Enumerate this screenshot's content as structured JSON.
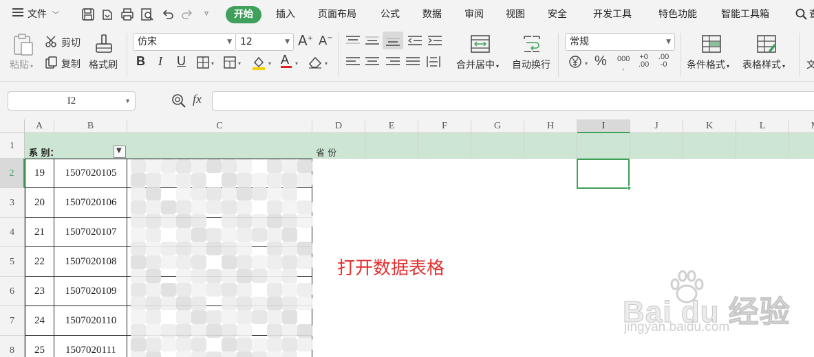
{
  "menu": {
    "file_label": "文件",
    "tabs": [
      "开始",
      "插入",
      "页面布局",
      "公式",
      "数据",
      "审阅",
      "视图",
      "安全",
      "开发工具",
      "特色功能",
      "智能工具箱",
      "查"
    ],
    "active_tab": "开始"
  },
  "ribbon": {
    "paste_label": "粘贴",
    "cut_label": "剪切",
    "copy_label": "复制",
    "format_painter_label": "格式刷",
    "font_name": "仿宋",
    "font_size": "12",
    "merge_center_label": "合并居中",
    "wrap_text_label": "自动换行",
    "number_format": "常规",
    "conditional_format_label": "条件格式",
    "table_style_label": "表格样式",
    "cut_off_label": "文",
    "bold": "B",
    "italic": "I",
    "underline": "U",
    "font_color_glyph": "A",
    "percent": "%",
    "thousands": "000",
    "inc_decimal": ".00",
    "dec_decimal": ".00",
    "inc_decimal_small": "+0",
    "dec_decimal_small": "-0",
    "font_grow": "A",
    "font_shrink": "A"
  },
  "formula_bar": {
    "name_box": "I2",
    "fx": "fx",
    "value": ""
  },
  "grid": {
    "columns": [
      "A",
      "B",
      "C",
      "D",
      "E",
      "F",
      "G",
      "H",
      "I",
      "J",
      "K",
      "L",
      "M"
    ],
    "selected_column": "I",
    "rows": [
      "1",
      "2",
      "3",
      "4",
      "5",
      "6",
      "7",
      "8"
    ],
    "selected_row": "2",
    "header_row": {
      "col_a": "系 别：",
      "col_d": "省 份"
    },
    "data": [
      {
        "a": "19",
        "b": "1507020105"
      },
      {
        "a": "20",
        "b": "1507020106"
      },
      {
        "a": "21",
        "b": "1507020107"
      },
      {
        "a": "22",
        "b": "1507020108"
      },
      {
        "a": "23",
        "b": "1507020109"
      },
      {
        "a": "24",
        "b": "1507020110"
      },
      {
        "a": "25",
        "b": "1507020111"
      }
    ]
  },
  "annotation": "打开数据表格",
  "watermark": {
    "logo": "Bai du 经验",
    "url": "jingyan.baidu.com"
  },
  "colors": {
    "accent": "#3ea05a",
    "header_row_bg": "#cde6d3",
    "annotation": "#e53030"
  }
}
